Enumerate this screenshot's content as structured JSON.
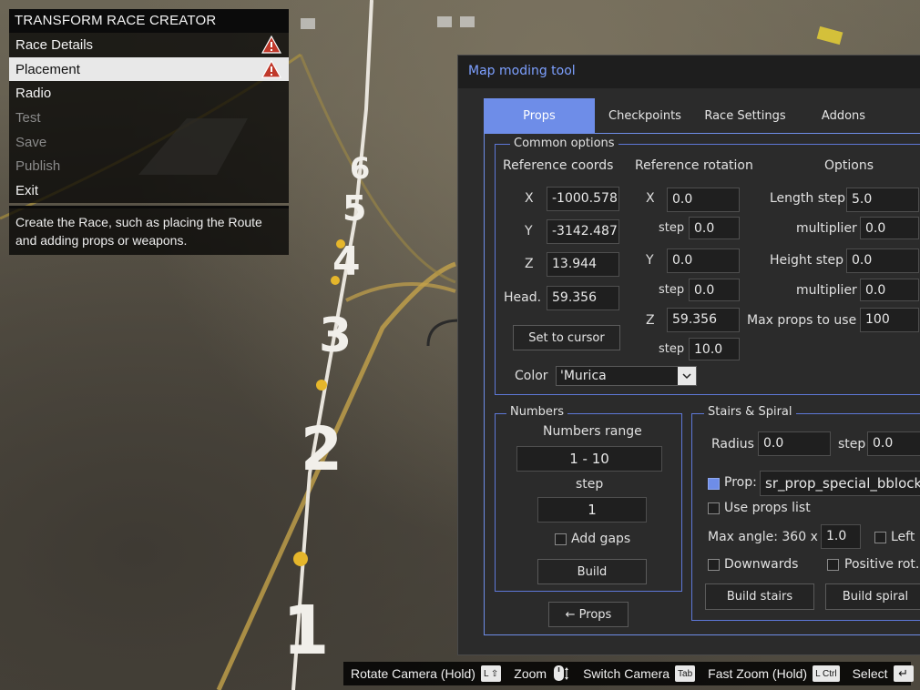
{
  "menu": {
    "title": "TRANSFORM RACE CREATOR",
    "items": [
      {
        "label": "Race Details",
        "state": "normal",
        "warning": true
      },
      {
        "label": "Placement",
        "state": "selected",
        "warning": true
      },
      {
        "label": "Radio",
        "state": "normal",
        "warning": false
      },
      {
        "label": "Test",
        "state": "disabled",
        "warning": false
      },
      {
        "label": "Save",
        "state": "disabled",
        "warning": false
      },
      {
        "label": "Publish",
        "state": "disabled",
        "warning": false
      },
      {
        "label": "Exit",
        "state": "normal",
        "warning": false
      }
    ],
    "description": "Create the Race, such as placing the Route and adding props or weapons.",
    "warning_icon": "warning-triangle-icon",
    "warning_color": "#c0392b"
  },
  "scene": {
    "number_markers": [
      "1",
      "2",
      "3",
      "4",
      "5",
      "6"
    ]
  },
  "tool": {
    "title": "Map moding tool",
    "accent_color": "#6e8de8",
    "tabs": [
      {
        "label": "Props",
        "active": true
      },
      {
        "label": "Checkpoints",
        "active": false
      },
      {
        "label": "Race Settings",
        "active": false
      },
      {
        "label": "Addons",
        "active": false
      }
    ],
    "common": {
      "legend": "Common options",
      "ref_coords": {
        "header": "Reference coords",
        "x_label": "X",
        "x_value": "-1000.578",
        "y_label": "Y",
        "y_value": "-3142.487",
        "z_label": "Z",
        "z_value": "13.944",
        "head_label": "Head.",
        "head_value": "59.356",
        "set_cursor_label": "Set to cursor"
      },
      "ref_rotation": {
        "header": "Reference rotation",
        "x_label": "X",
        "x_value": "0.0",
        "x_step_label": "step",
        "x_step_value": "0.0",
        "y_label": "Y",
        "y_value": "0.0",
        "y_step_label": "step",
        "y_step_value": "0.0",
        "z_label": "Z",
        "z_value": "59.356",
        "z_step_label": "step",
        "z_step_value": "10.0"
      },
      "options": {
        "header": "Options",
        "length_step_label": "Length step",
        "length_step_value": "5.0",
        "length_mult_label": "multiplier",
        "length_mult_value": "0.0",
        "height_step_label": "Height step",
        "height_step_value": "0.0",
        "height_mult_label": "multiplier",
        "height_mult_value": "0.0",
        "max_props_label": "Max props to use",
        "max_props_value": "100"
      },
      "color_label": "Color",
      "color_value": "'Murica"
    },
    "numbers": {
      "legend": "Numbers",
      "range_label": "Numbers range",
      "range_value": "1  -  10",
      "step_label": "step",
      "step_value": "1",
      "add_gaps_label": "Add gaps",
      "add_gaps_checked": false,
      "build_label": "Build"
    },
    "stairs": {
      "legend": "Stairs & Spiral",
      "radius_label": "Radius",
      "radius_value": "0.0",
      "step_label": "step",
      "step_value": "0.0",
      "prop_label": "Prop:",
      "prop_checked": true,
      "prop_value": "sr_prop_special_bblock",
      "use_list_label": "Use props list",
      "use_list_checked": false,
      "max_angle_label": "Max angle: 360 x",
      "max_angle_value": "1.0",
      "left_label": "Left",
      "left_checked": false,
      "downwards_label": "Downwards",
      "downwards_checked": false,
      "positive_rot_label": "Positive rot.",
      "positive_rot_checked": false,
      "build_stairs_label": "Build stairs",
      "build_spiral_label": "Build spiral"
    },
    "back_button_label": "← Props"
  },
  "helpbar": {
    "hints": [
      {
        "label": "Rotate Camera (Hold)",
        "key": "L ⇧",
        "icon": "left-stick-icon"
      },
      {
        "label": "Zoom",
        "key": "",
        "icon": "mouse-scroll-icon"
      },
      {
        "label": "Switch Camera",
        "key": "Tab",
        "icon": "tab-key-icon"
      },
      {
        "label": "Fast Zoom (Hold)",
        "key": "L Ctrl",
        "icon": "ctrl-key-icon"
      },
      {
        "label": "Select",
        "key": "↵",
        "icon": "enter-key-icon"
      }
    ]
  }
}
